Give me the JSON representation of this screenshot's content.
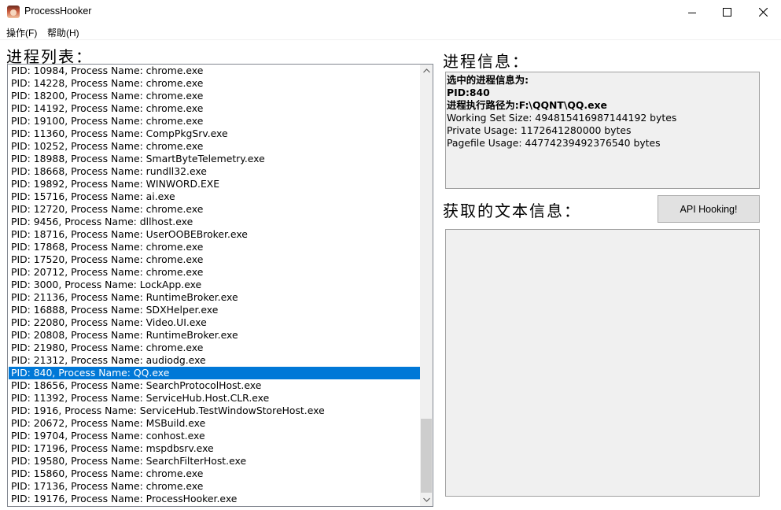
{
  "window": {
    "title": "ProcessHooker",
    "icon": "app-icon",
    "controls": [
      "minimize-icon",
      "maximize-icon",
      "close-icon"
    ]
  },
  "menu": {
    "items": [
      {
        "label": "操作(F)"
      },
      {
        "label": "帮助(H)"
      }
    ]
  },
  "process_list": {
    "heading": "进程列表：",
    "items": [
      "PID: 10984, Process Name: chrome.exe",
      "PID: 14228, Process Name: chrome.exe",
      "PID: 18200, Process Name: chrome.exe",
      "PID: 14192, Process Name: chrome.exe",
      "PID: 19100, Process Name: chrome.exe",
      "PID: 11360, Process Name: CompPkgSrv.exe",
      "PID: 10252, Process Name: chrome.exe",
      "PID: 18988, Process Name: SmartByteTelemetry.exe",
      "PID: 18668, Process Name: rundll32.exe",
      "PID: 19892, Process Name: WINWORD.EXE",
      "PID: 15716, Process Name: ai.exe",
      "PID: 12720, Process Name: chrome.exe",
      "PID: 9456, Process Name: dllhost.exe",
      "PID: 18716, Process Name: UserOOBEBroker.exe",
      "PID: 17868, Process Name: chrome.exe",
      "PID: 17520, Process Name: chrome.exe",
      "PID: 20712, Process Name: chrome.exe",
      "PID: 3000, Process Name: LockApp.exe",
      "PID: 21136, Process Name: RuntimeBroker.exe",
      "PID: 16888, Process Name: SDXHelper.exe",
      "PID: 22080, Process Name: Video.UI.exe",
      "PID: 20808, Process Name: RuntimeBroker.exe",
      "PID: 21980, Process Name: chrome.exe",
      "PID: 21312, Process Name: audiodg.exe",
      "PID: 840, Process Name: QQ.exe",
      "PID: 18656, Process Name: SearchProtocolHost.exe",
      "PID: 11392, Process Name: ServiceHub.Host.CLR.exe",
      "PID: 1916, Process Name: ServiceHub.TestWindowStoreHost.exe",
      "PID: 20672, Process Name: MSBuild.exe",
      "PID: 19704, Process Name: conhost.exe",
      "PID: 17196, Process Name: mspdbsrv.exe",
      "PID: 19580, Process Name: SearchFilterHost.exe",
      "PID: 15860, Process Name: chrome.exe",
      "PID: 17136, Process Name: chrome.exe",
      "PID: 19176, Process Name: ProcessHooker.exe"
    ],
    "selected_index": 24,
    "selection_color": "#0078d7"
  },
  "process_info": {
    "heading": "进程信息：",
    "lines": [
      "选中的进程信息为:",
      "PID:840",
      "进程执行路径为:F:\\QQNT\\QQ.exe",
      "Working Set Size: 494815416987144192 bytes",
      "Private Usage: 1172641280000 bytes",
      "Pagefile Usage: 44774239492376540 bytes"
    ]
  },
  "text_info": {
    "heading": "获取的文本信息：",
    "button_label": "API Hooking!",
    "content": ""
  }
}
